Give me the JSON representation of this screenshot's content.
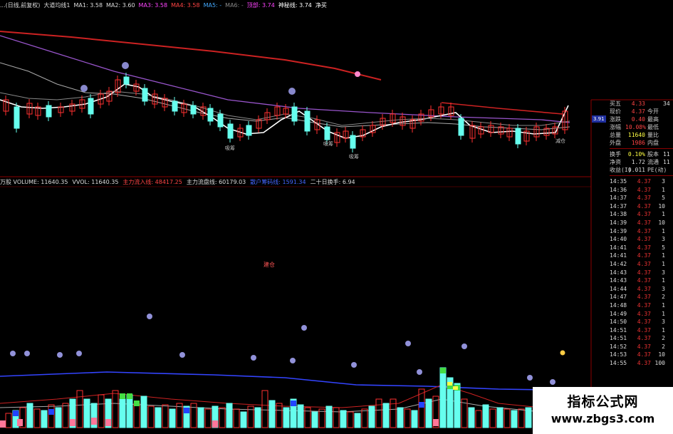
{
  "header": {
    "items": [
      {
        "text": "...(日线,前复权)",
        "color": "#dddddd"
      },
      {
        "text": "大道均线1",
        "color": "#dddddd"
      },
      {
        "text": "MA1: 3.58",
        "color": "#dddddd"
      },
      {
        "text": "MA2: 3.60",
        "color": "#dddddd"
      },
      {
        "text": "MA3: 3.58",
        "color": "#ff44ff"
      },
      {
        "text": "MA4: 3.58",
        "color": "#ff4444"
      },
      {
        "text": "MA5: -",
        "color": "#44aaff"
      },
      {
        "text": "MA6: -",
        "color": "#888888"
      },
      {
        "text": "顶部: 3.74",
        "color": "#ff44ff"
      },
      {
        "text": "神秘线: 3.74",
        "color": "#ffffff"
      },
      {
        "text": "净买",
        "color": "#ffffff"
      }
    ]
  },
  "volume_header": {
    "items": [
      {
        "text": "万股 VOLUME: 11640.35",
        "color": "#dddddd"
      },
      {
        "text": "VVOL: 11640.35",
        "color": "#dddddd"
      },
      {
        "text": "主力流入线: 48417.25",
        "color": "#ff4444"
      },
      {
        "text": "主力流盘线: 60179.03",
        "color": "#dddddd"
      },
      {
        "text": "散户筹码线: 1591.34",
        "color": "#4466ff"
      },
      {
        "text": "二十日换手: 6.94",
        "color": "#dddddd"
      }
    ]
  },
  "chart_labels": {
    "kline_tags": [
      "吸筹",
      "吸筹",
      "吸筹",
      "减仓"
    ],
    "price_marker": "3.91",
    "mid_tag": "建仓"
  },
  "quote_panel": {
    "rows": [
      {
        "k": "买五",
        "v": "4.33",
        "k2": "",
        "v2": "34",
        "vcolor": "#ff4444"
      },
      {
        "k": "现价",
        "v": "4.37",
        "k2": "今开",
        "v2": "",
        "vcolor": "#ff4444"
      },
      {
        "k": "涨跌",
        "v": "0.40",
        "k2": "最高",
        "v2": "",
        "vcolor": "#ff4444"
      },
      {
        "k": "涨幅",
        "v": "10.08%",
        "k2": "最低",
        "v2": "",
        "vcolor": "#ff4444"
      },
      {
        "k": "总量",
        "v": "11640",
        "k2": "量比",
        "v2": "",
        "vcolor": "#ffff44"
      },
      {
        "k": "外盘",
        "v": "1986",
        "k2": "内盘",
        "v2": "",
        "vcolor": "#ff4444"
      }
    ],
    "rows2": [
      {
        "k": "换手",
        "v": "0.10%",
        "k2": "股本",
        "v2": "11",
        "vcolor": "#ffff44"
      },
      {
        "k": "净资",
        "v": "1.72",
        "k2": "流通",
        "v2": "11",
        "vcolor": "#dddddd"
      },
      {
        "k": "收益(I)",
        "v": "0.011",
        "k2": "PE(动)",
        "v2": "",
        "vcolor": "#dddddd"
      }
    ]
  },
  "ticks": [
    {
      "t": "14:35",
      "p": "4.37",
      "v": "3"
    },
    {
      "t": "14:36",
      "p": "4.37",
      "v": "1"
    },
    {
      "t": "14:37",
      "p": "4.37",
      "v": "5"
    },
    {
      "t": "14:37",
      "p": "4.37",
      "v": "10"
    },
    {
      "t": "14:38",
      "p": "4.37",
      "v": "1"
    },
    {
      "t": "14:39",
      "p": "4.37",
      "v": "10"
    },
    {
      "t": "14:39",
      "p": "4.37",
      "v": "1"
    },
    {
      "t": "14:40",
      "p": "4.37",
      "v": "3"
    },
    {
      "t": "14:41",
      "p": "4.37",
      "v": "5"
    },
    {
      "t": "14:41",
      "p": "4.37",
      "v": "1"
    },
    {
      "t": "14:42",
      "p": "4.37",
      "v": "1"
    },
    {
      "t": "14:43",
      "p": "4.37",
      "v": "3"
    },
    {
      "t": "14:43",
      "p": "4.37",
      "v": "1"
    },
    {
      "t": "14:44",
      "p": "4.37",
      "v": "3"
    },
    {
      "t": "14:47",
      "p": "4.37",
      "v": "2"
    },
    {
      "t": "14:48",
      "p": "4.37",
      "v": "1"
    },
    {
      "t": "14:49",
      "p": "4.37",
      "v": "1"
    },
    {
      "t": "14:50",
      "p": "4.37",
      "v": "3"
    },
    {
      "t": "14:51",
      "p": "4.37",
      "v": "1"
    },
    {
      "t": "14:51",
      "p": "4.37",
      "v": "2"
    },
    {
      "t": "14:52",
      "p": "4.37",
      "v": "2"
    },
    {
      "t": "14:53",
      "p": "4.37",
      "v": "10"
    },
    {
      "t": "14:55",
      "p": "4.37",
      "v": "100"
    }
  ],
  "vol_axis_ticks": [
    "",
    "",
    "",
    "",
    "",
    "",
    "",
    "",
    "",
    "",
    "",
    "",
    ""
  ],
  "watermark": {
    "line1": "指标公式网",
    "line2": "www.zbgs3.com"
  },
  "colors": {
    "up": "#ff3030",
    "down": "#66ffee",
    "ma_slow": "#cc2222",
    "ma_purple": "#9955cc",
    "ma_white": "#ffffff",
    "grid": "#8b0000",
    "marker": "#aaaaff",
    "volume_highlight_green": "#44dd44",
    "volume_highlight_blue": "#2244ff"
  }
}
